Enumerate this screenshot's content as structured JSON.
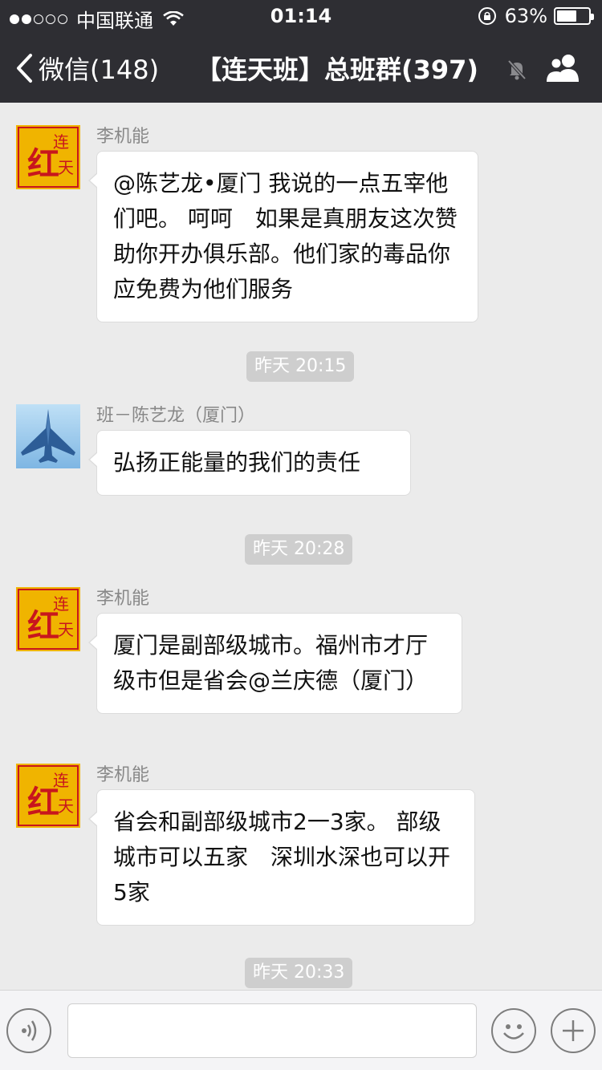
{
  "status_bar": {
    "carrier": "中国联通",
    "time": "01:14",
    "battery_percent": "63%",
    "battery_level": 0.63,
    "signal_bars_filled": 2
  },
  "nav": {
    "back_label": "微信(148)",
    "title": "【连天班】总班群(397)"
  },
  "messages": [
    {
      "sender": "李机能",
      "avatar": "red-calligraphy-avatar",
      "text": "@陈艺龙•厦门 我说的一点五宰他们吧。 呵呵　如果是真朋友这次赞助你开办俱乐部。他们家的毒品你应免费为他们服务"
    },
    {
      "timestamp": "昨天 20:15"
    },
    {
      "sender": "班－陈艺龙（厦门）",
      "avatar": "fighter-jet-avatar",
      "text": "弘扬正能量的我们的责任"
    },
    {
      "timestamp": "昨天 20:28"
    },
    {
      "sender": "李机能",
      "avatar": "red-calligraphy-avatar",
      "text": "厦门是副部级城市。福州市才厅级市但是省会@兰庆德（厦门）"
    },
    {
      "sender": "李机能",
      "avatar": "red-calligraphy-avatar",
      "text": "省会和副部级城市2一3家。 部级城市可以五家　深圳水深也可以开5家"
    },
    {
      "timestamp": "昨天 20:33"
    }
  ],
  "avatar_red_glyphs": "红连天",
  "input": {
    "value": "",
    "placeholder": ""
  },
  "colors": {
    "header_bg": "#2e2e33",
    "chat_bg": "#ebebeb",
    "bubble_bg": "#ffffff",
    "timestamp_bg": "#cecece",
    "avatar_red": "#c8161d",
    "avatar_gold": "#f0b400"
  }
}
